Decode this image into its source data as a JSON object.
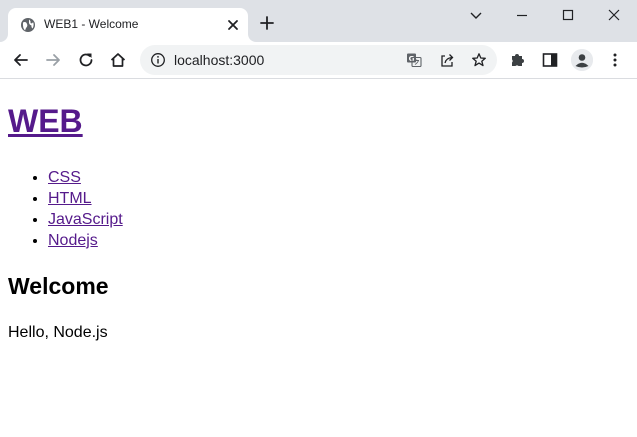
{
  "tab": {
    "title": "WEB1 - Welcome",
    "favicon": "globe-icon"
  },
  "address_bar": {
    "url": "localhost:3000",
    "site_info_icon": "info-icon"
  },
  "toolbar_icons": [
    "back-icon",
    "forward-icon",
    "reload-icon",
    "home-icon",
    "translate-icon",
    "share-icon",
    "star-icon",
    "extensions-icon",
    "side-panel-icon",
    "profile-icon",
    "menu-icon"
  ],
  "page": {
    "title": "WEB",
    "nav": [
      {
        "label": "CSS"
      },
      {
        "label": "HTML"
      },
      {
        "label": "JavaScript"
      },
      {
        "label": "Nodejs"
      }
    ],
    "heading": "Welcome",
    "body": "Hello, Node.js"
  },
  "colors": {
    "visited_link": "#551a8b",
    "titlebar": "#dee1e6",
    "omnibox": "#f1f3f4"
  }
}
